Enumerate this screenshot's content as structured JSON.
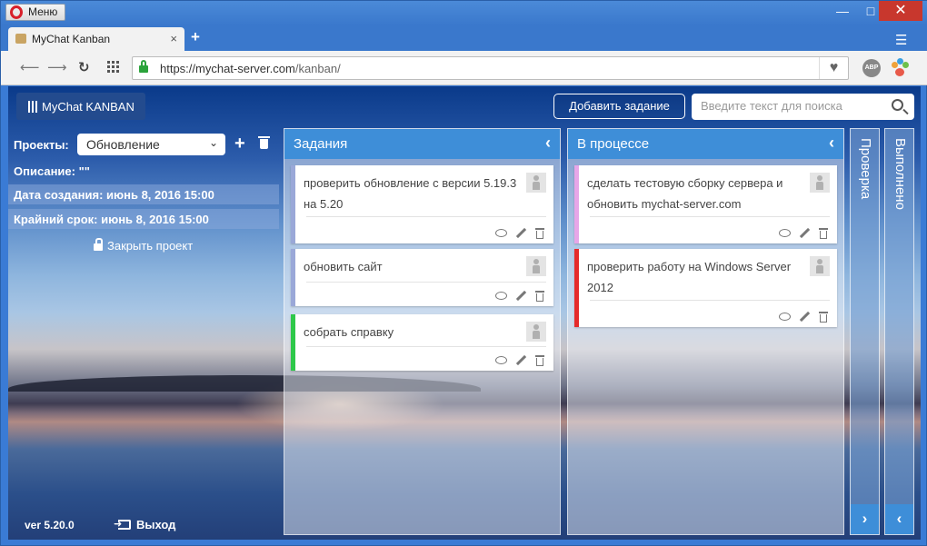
{
  "browser": {
    "menu_label": "Меню",
    "tab_title": "MyChat Kanban",
    "tab_close": "×",
    "new_tab": "+",
    "url_scheme_host": "https://mychat-server.com",
    "url_path": "/kanban/",
    "window_controls": {
      "minimize": "—",
      "maximize": "□",
      "close": "✕"
    },
    "extensions": {
      "adblock": "ABP"
    },
    "icons": [
      "opera-icon",
      "back-icon",
      "forward-icon",
      "reload-icon",
      "speed-dial-icon",
      "lock-icon",
      "heart-icon",
      "abp-icon",
      "paw-icon"
    ]
  },
  "header": {
    "brand": "MyChat KANBAN",
    "add_task": "Добавить задание",
    "search_placeholder": "Введите текст для поиска"
  },
  "project_panel": {
    "projects_label": "Проекты:",
    "selected_project": "Обновление",
    "description": "Описание: \"\"",
    "created": "Дата создания: июнь 8, 2016 15:00",
    "deadline": "Крайний срок: июнь 8, 2016 15:00",
    "close_project": "Закрыть проект",
    "version": "ver 5.20.0",
    "logout": "Выход"
  },
  "columns": [
    {
      "title": "Задания",
      "collapse": "‹",
      "cards": [
        {
          "text": "проверить обновление с версии 5.19.3 на 5.20",
          "color": "#9aa8d8"
        },
        {
          "text": "обновить сайт",
          "color": "#9aa8d8"
        },
        {
          "text": "собрать справку",
          "color": "#2ec84a"
        }
      ]
    },
    {
      "title": "В процессе",
      "collapse": "‹",
      "cards": [
        {
          "text": "сделать тестовую сборку сервера и обновить mychat-server.com",
          "color": "#e7a6e8"
        },
        {
          "text": "проверить работу на Windows Server 2012",
          "color": "#e52b2b"
        }
      ]
    }
  ],
  "side_columns": [
    {
      "title": "Проверка",
      "expand": "›"
    },
    {
      "title": "Выполнено",
      "expand": "‹"
    }
  ],
  "colors": {
    "accent": "#3e8ed8",
    "brand_bg": "#234b8e",
    "chrome": "#3a7bd5"
  }
}
